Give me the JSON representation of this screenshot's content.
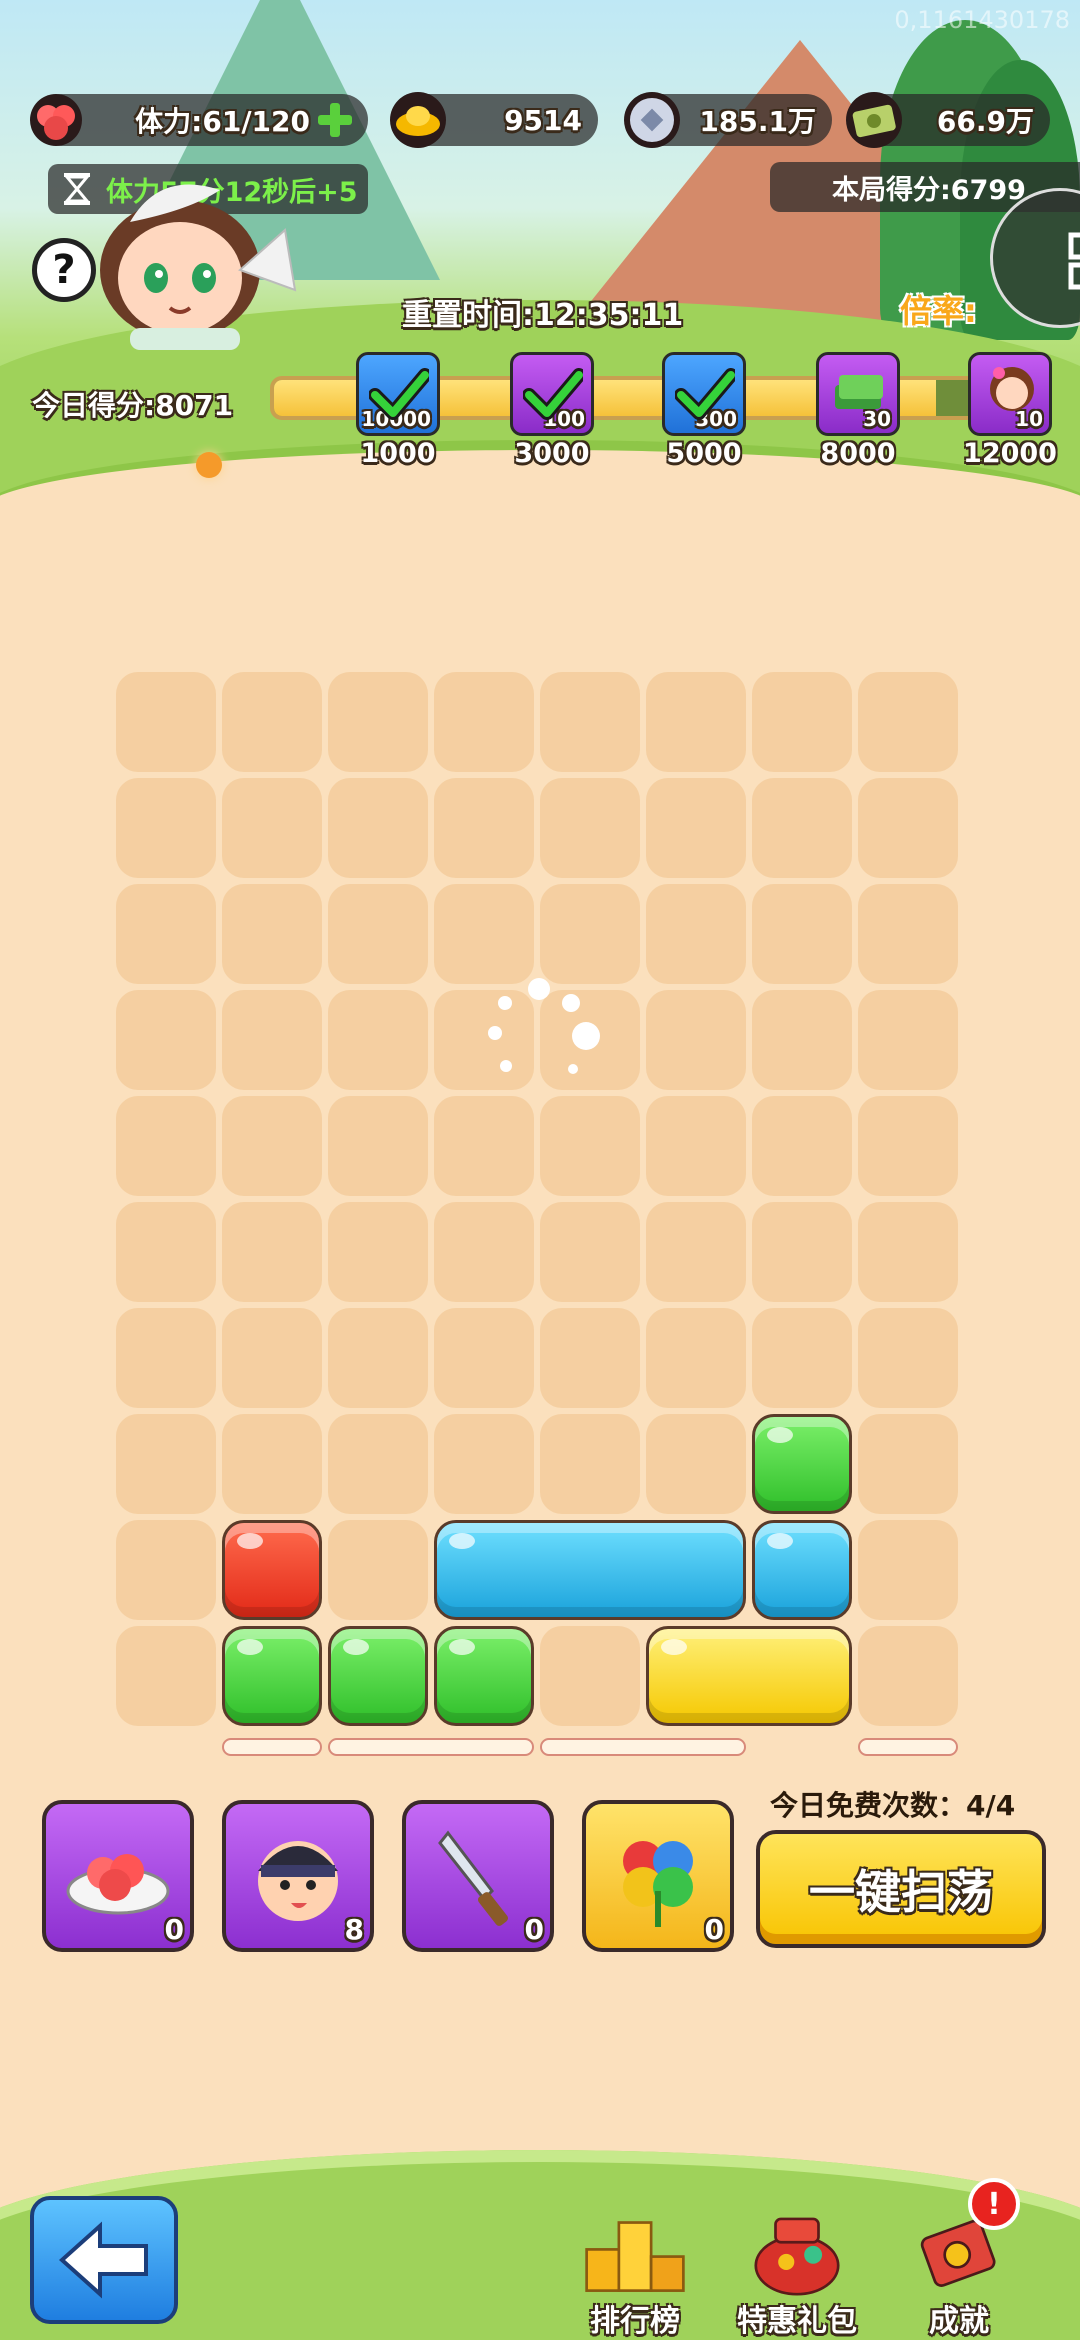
{
  "debug": {
    "id_text": "0,1161430178"
  },
  "resources": {
    "stamina": {
      "icon": "meat-icon",
      "value": "体力:61/120"
    },
    "gold": {
      "icon": "gold-ingot-icon",
      "value": "9514"
    },
    "silver": {
      "icon": "silver-coin-icon",
      "value": "185.1万"
    },
    "cash": {
      "icon": "banknote-icon",
      "value": "66.9万"
    }
  },
  "stamina_timer": "体力57分12秒后+5",
  "round_score": "本局得分:6799",
  "reset_time": "重置时间:12:35:11",
  "multiplier_label": "倍率:",
  "today_score": "今日得分:8071",
  "progress": {
    "fraction": 0.88
  },
  "milestones": [
    {
      "threshold": "1000",
      "reward_count": "10000",
      "claimed": true,
      "icon": "silver-coin-icon"
    },
    {
      "threshold": "3000",
      "reward_count": "100",
      "claimed": true,
      "icon": "gold-ingot-icon"
    },
    {
      "threshold": "5000",
      "reward_count": "300",
      "claimed": true,
      "icon": "banknote-icon"
    },
    {
      "threshold": "8000",
      "reward_count": "30",
      "claimed": false,
      "icon": "banknote-stack-icon"
    },
    {
      "threshold": "12000",
      "reward_count": "10",
      "claimed": false,
      "icon": "hero-portrait-icon"
    }
  ],
  "board": {
    "rows": 10,
    "cols": 8,
    "blocks": [
      {
        "row": 7,
        "col": 6,
        "span": 1,
        "color": "green"
      },
      {
        "row": 8,
        "col": 1,
        "span": 1,
        "color": "red"
      },
      {
        "row": 8,
        "col": 3,
        "span": 3,
        "color": "blue"
      },
      {
        "row": 8,
        "col": 6,
        "span": 1,
        "color": "blue"
      },
      {
        "row": 9,
        "col": 1,
        "span": 1,
        "color": "green"
      },
      {
        "row": 9,
        "col": 2,
        "span": 1,
        "color": "green"
      },
      {
        "row": 9,
        "col": 3,
        "span": 1,
        "color": "green"
      },
      {
        "row": 9,
        "col": 5,
        "span": 2,
        "color": "yellow"
      }
    ],
    "colors": {
      "red": "#e22a18",
      "green": "#2fbf2a",
      "blue": "#1aa2db",
      "yellow": "#f5c800"
    }
  },
  "items": [
    {
      "name": "meat-plate-icon",
      "count": "0",
      "style": "purple"
    },
    {
      "name": "hero-face-icon",
      "count": "8",
      "style": "purple"
    },
    {
      "name": "knife-icon",
      "count": "0",
      "style": "purple"
    },
    {
      "name": "flower-icon",
      "count": "0",
      "style": "gold"
    }
  ],
  "free_count_text": "今日免费次数：4/4",
  "sweep_button": "一键扫荡",
  "nav": {
    "leaderboard": "排行榜",
    "special_pack": "特惠礼包",
    "achievements": "成就",
    "badge": "!"
  }
}
